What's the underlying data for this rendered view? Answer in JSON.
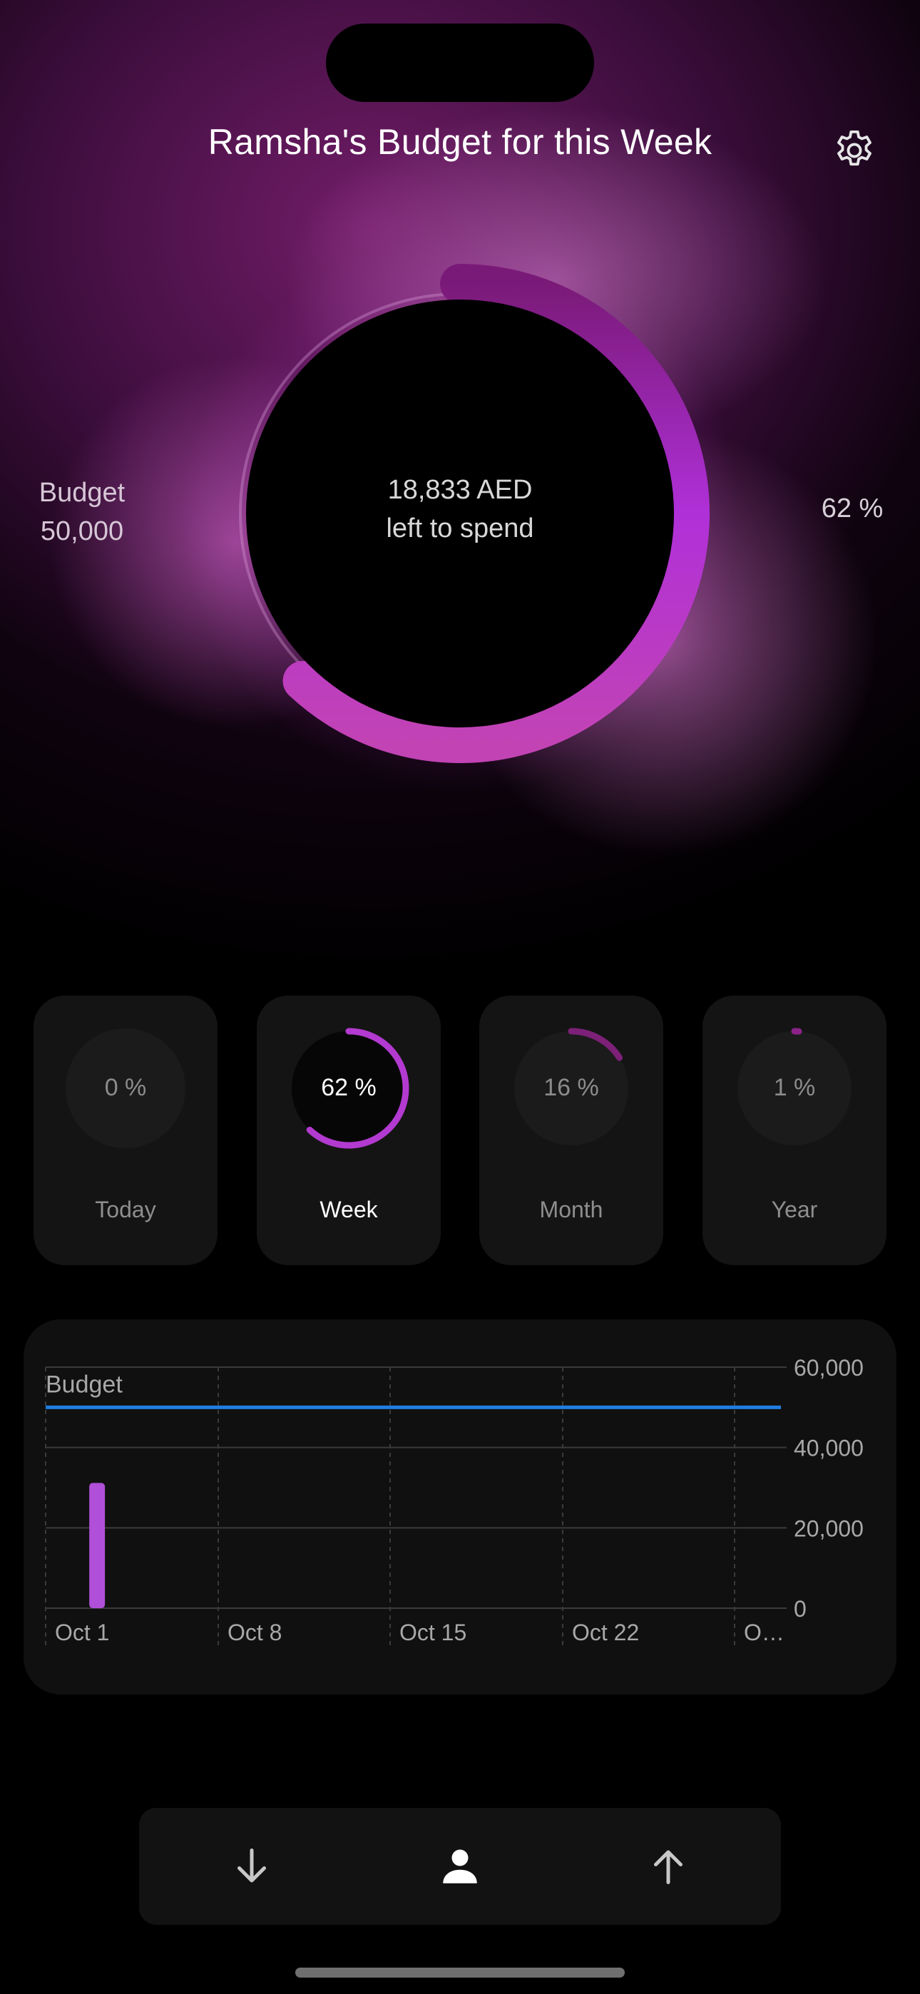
{
  "header": {
    "title": "Ramsha's Budget for this Week",
    "settings_icon": "gear-icon"
  },
  "summary": {
    "amount_left": "18,833 AED",
    "left_caption": "left to spend",
    "budget_label": "Budget",
    "budget_value": "50,000",
    "percent_label": "62 %",
    "progress_fraction": 0.62
  },
  "periods": [
    {
      "label": "Today",
      "percent": "0 %",
      "fraction": 0.0,
      "active": false
    },
    {
      "label": "Week",
      "percent": "62 %",
      "fraction": 0.62,
      "active": true
    },
    {
      "label": "Month",
      "percent": "16 %",
      "fraction": 0.16,
      "active": false
    },
    {
      "label": "Year",
      "percent": "1 %",
      "fraction": 0.01,
      "active": false
    }
  ],
  "chart_data": {
    "type": "bar",
    "x_ticks": [
      "Oct 1",
      "Oct 8",
      "Oct 15",
      "Oct 22",
      "O…"
    ],
    "y_ticks": [
      "0",
      "20,000",
      "40,000",
      "60,000"
    ],
    "ylim": [
      0,
      60000
    ],
    "bars": [
      {
        "date": "Oct 3",
        "value": 31167
      }
    ],
    "reference_line": {
      "label": "Budget",
      "value": 50000,
      "color": "#1f7de0"
    },
    "bar_color": "#b04fd8"
  },
  "tabbar": {
    "items": [
      {
        "name": "down-arrow-icon"
      },
      {
        "name": "person-icon"
      },
      {
        "name": "up-arrow-icon"
      }
    ]
  },
  "colors": {
    "accent_purple": "#b436d6",
    "accent_pink": "#d050b8",
    "budget_line": "#1f7de0"
  }
}
